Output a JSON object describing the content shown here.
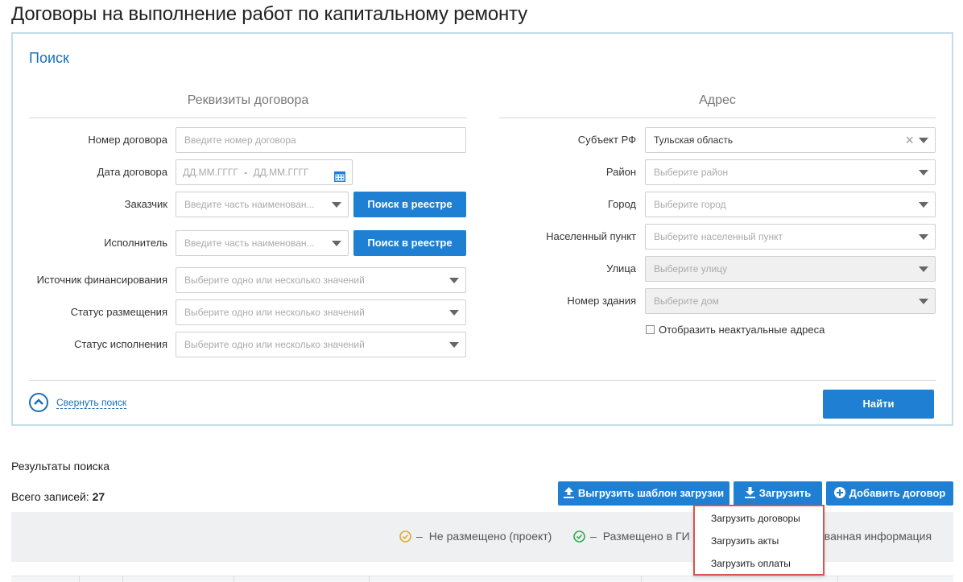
{
  "page": {
    "title": "Договоры на выполнение работ по капитальному ремонту"
  },
  "search": {
    "title": "Поиск",
    "contract_section": {
      "title": "Реквизиты договора",
      "number": {
        "label": "Номер договора",
        "placeholder": "Введите номер договора"
      },
      "date": {
        "label": "Дата договора",
        "from_placeholder": "ДД.ММ.ГГГГ",
        "separator": "-",
        "to_placeholder": "ДД.ММ.ГГГГ"
      },
      "customer": {
        "label": "Заказчик",
        "placeholder": "Введите часть наименован...",
        "button": "Поиск в реестре"
      },
      "executor": {
        "label": "Исполнитель",
        "placeholder": "Введите часть наименован...",
        "button": "Поиск в реестре"
      },
      "funding": {
        "label": "Источник финансирования",
        "placeholder": "Выберите одно или несколько значений"
      },
      "placement_status": {
        "label": "Статус размещения",
        "placeholder": "Выберите одно или несколько значений"
      },
      "execution_status": {
        "label": "Статус исполнения",
        "placeholder": "Выберите одно или несколько значений"
      }
    },
    "address_section": {
      "title": "Адрес",
      "subject": {
        "label": "Субъект РФ",
        "value": "Тульская область"
      },
      "district": {
        "label": "Район",
        "placeholder": "Выберите район"
      },
      "city": {
        "label": "Город",
        "placeholder": "Выберите город"
      },
      "settlement": {
        "label": "Населенный пункт",
        "placeholder": "Выберите населенный пункт"
      },
      "street": {
        "label": "Улица",
        "placeholder": "Выберите улицу"
      },
      "building": {
        "label": "Номер здания",
        "placeholder": "Выберите дом"
      },
      "show_outdated": {
        "label": "Отобразить неактуальные адреса",
        "checked": false
      }
    },
    "collapse_label": "Свернуть поиск",
    "find_button": "Найти"
  },
  "results": {
    "title": "Результаты поиска",
    "total_label": "Всего записей:",
    "total_count": "27",
    "buttons": {
      "template": "Выгрузить шаблон загрузки",
      "upload": "Загрузить",
      "add": "Добавить договор"
    },
    "legend": [
      {
        "dash": "–",
        "text": "Не размещено (проект)",
        "color": "#e0a82e"
      },
      {
        "dash": "–",
        "text": "Размещено в ГИ",
        "color": "#2fa84f"
      },
      {
        "text": "ованная информация"
      }
    ]
  },
  "upload_menu": {
    "items": [
      "Загрузить договоры",
      "Загрузить акты",
      "Загрузить оплаты"
    ]
  },
  "colors": {
    "accent": "#1e7fd3",
    "title_blue": "#1a6fb8",
    "highlight_red": "#d9534f"
  }
}
